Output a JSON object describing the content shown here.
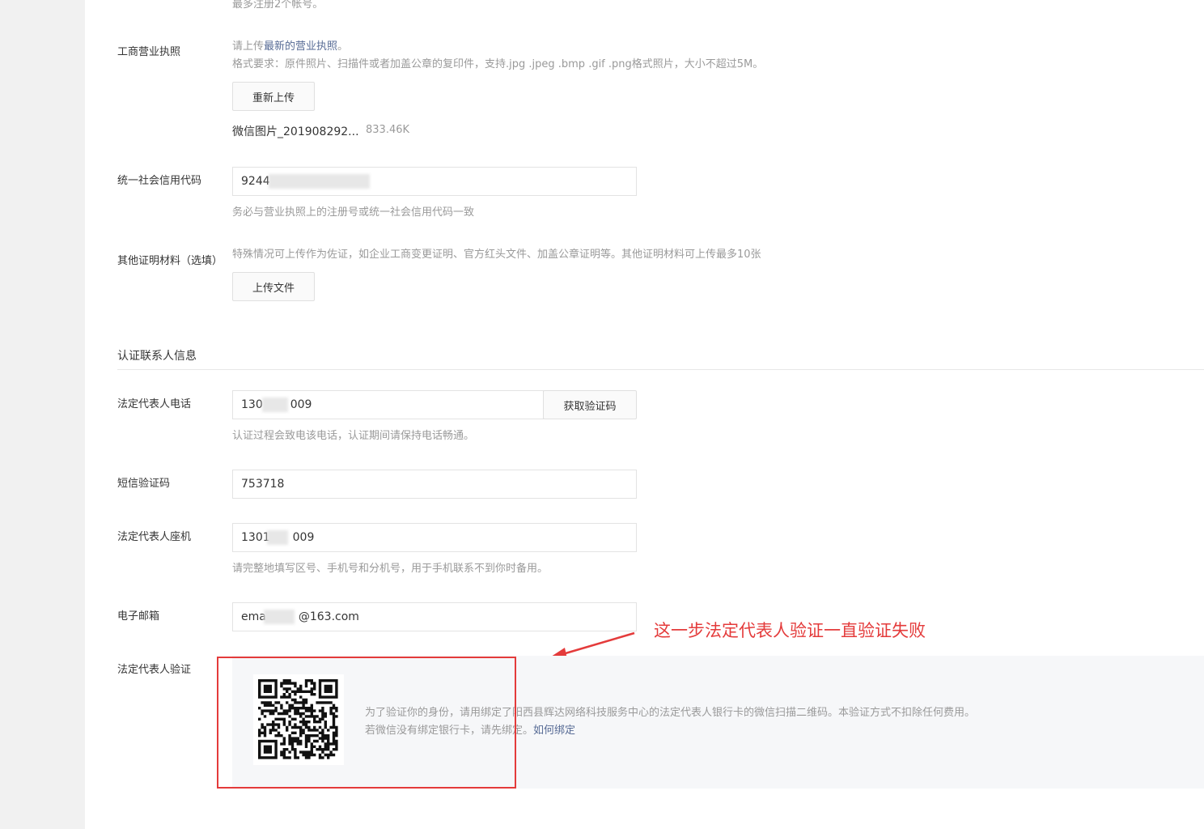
{
  "top_note": "最多注册2个帐号。",
  "license": {
    "label": "工商营业执照",
    "hint_prefix": "请上传",
    "hint_link": "最新的营业执照",
    "hint_suffix": "。",
    "format": "格式要求：原件照片、扫描件或者加盖公章的复印件，支持.jpg .jpeg .bmp .gif .png格式照片，大小不超过5M。",
    "reupload_button": "重新上传",
    "file_name": "微信图片_201908292...",
    "file_size": "833.46K"
  },
  "credit_code": {
    "label": "统一社会信用代码",
    "value": "9244",
    "hint": "务必与营业执照上的注册号或统一社会信用代码一致"
  },
  "other_docs": {
    "label": "其他证明材料（选填）",
    "hint": "特殊情况可上传作为佐证，如企业工商变更证明、官方红头文件、加盖公章证明等。其他证明材料可上传最多10张",
    "upload_button": "上传文件"
  },
  "contact_section": {
    "title": "认证联系人信息"
  },
  "phone": {
    "label": "法定代表人电话",
    "value_prefix": "130",
    "value_suffix": "009",
    "get_code_button": "获取验证码",
    "hint": "认证过程会致电该电话，认证期间请保持电话畅通。"
  },
  "sms_code": {
    "label": "短信验证码",
    "value": "753718"
  },
  "landline": {
    "label": "法定代表人座机",
    "value_prefix": "1301",
    "value_suffix": "009",
    "hint": "请完整地填写区号、手机号和分机号，用于手机联系不到你时备用。"
  },
  "email": {
    "label": "电子邮箱",
    "value_prefix": "ema",
    "value_suffix": "@163.com"
  },
  "legal_verify": {
    "label": "法定代表人验证",
    "desc": "为了验证你的身份，请用绑定了阳西县辉达网络科技服务中心的法定代表人银行卡的微信扫描二维码。本验证方式不扣除任何费用。",
    "desc2_prefix": "若微信没有绑定银行卡，请先绑定。",
    "desc2_link": "如何绑定"
  },
  "annotation": {
    "text": "这一步法定代表人验证一直验证失败"
  },
  "colors": {
    "link": "#576b95",
    "annotation_red": "#e43b3b",
    "hint_gray": "#9a9a9a"
  }
}
